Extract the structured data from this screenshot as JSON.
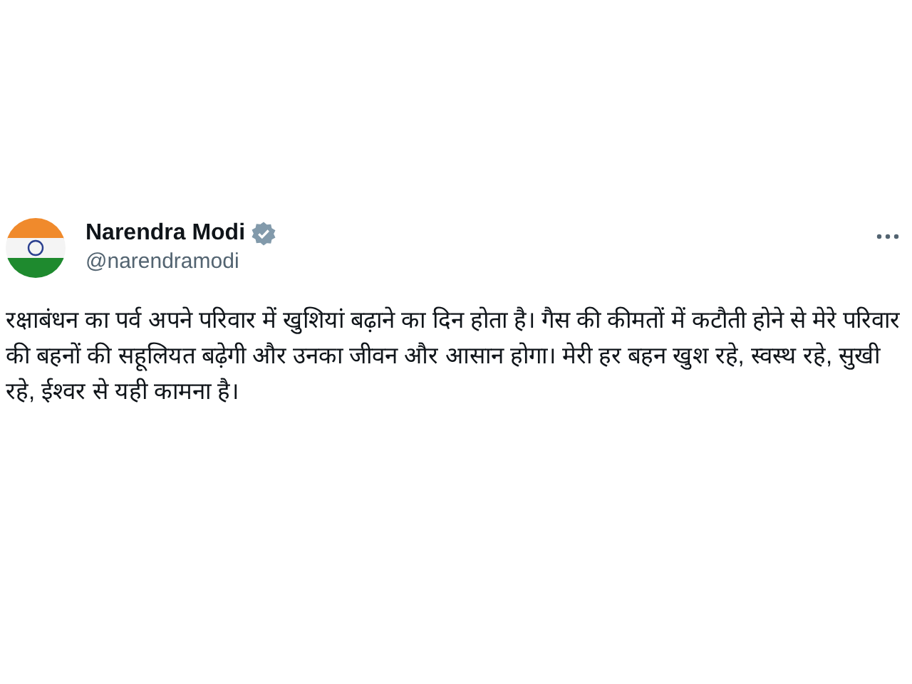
{
  "post": {
    "author": {
      "name": "Narendra Modi",
      "handle": "@narendramodi",
      "verified": true
    },
    "text": "रक्षाबंधन का पर्व अपने परिवार में खुशियां बढ़ाने का दिन होता है। गैस की कीमतों में कटौती होने से मेरे परिवार की बहनों की सहूलियत बढ़ेगी और उनका जीवन और आसान होगा। मेरी हर बहन खुश रहे, स्वस्थ रहे, सुखी रहे, ईश्वर से यही कामना है।"
  }
}
